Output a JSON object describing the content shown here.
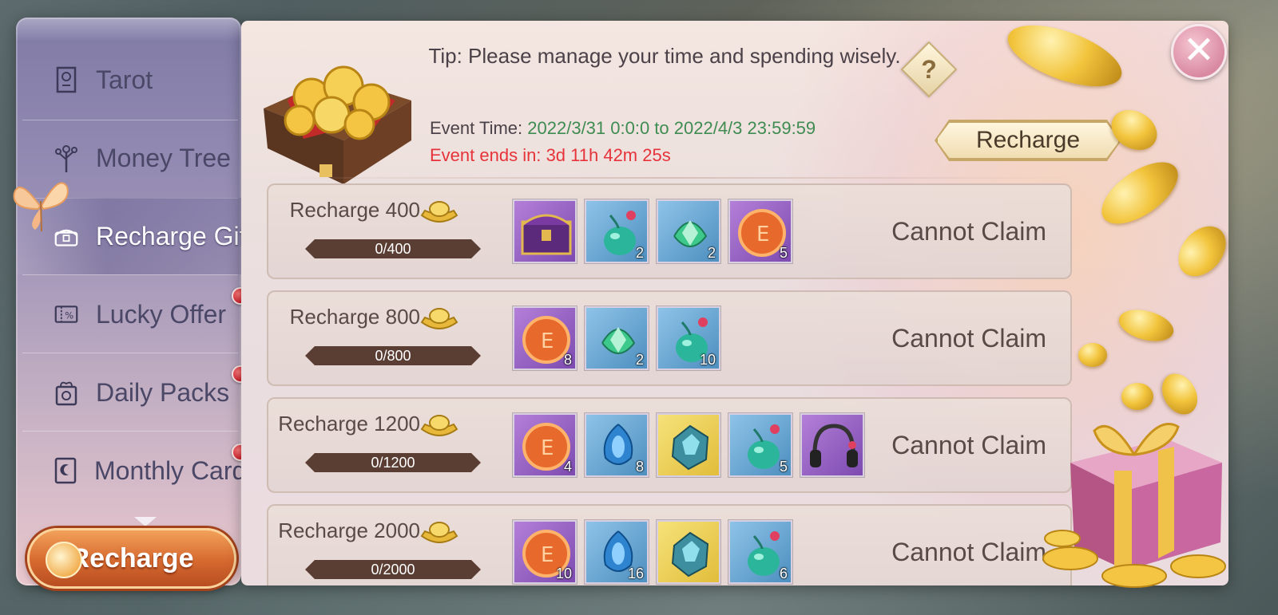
{
  "sidebar": {
    "items": [
      {
        "label": "Tarot",
        "icon": "tarot-card-icon"
      },
      {
        "label": "Money Tree",
        "icon": "money-tree-icon"
      },
      {
        "label": "Recharge Gift",
        "icon": "gift-chest-icon",
        "active": true
      },
      {
        "label": "Lucky Offer",
        "icon": "discount-ticket-icon",
        "badge": true
      },
      {
        "label": "Daily Packs",
        "icon": "daily-pack-icon",
        "badge": true
      },
      {
        "label": "Monthly Card",
        "icon": "monthly-card-icon",
        "badge": true
      }
    ],
    "recharge_label": "Recharge"
  },
  "header": {
    "tip": "Tip: Please manage your time and spending wisely.",
    "help_label": "?",
    "event_time_label": "Event Time:",
    "event_time_value": "2022/3/31 0:0:0 to 2022/4/3 23:59:59",
    "event_ends_label": "Event ends in:",
    "event_ends_value": "3d 11h 42m 25s",
    "recharge_button": "Recharge"
  },
  "tiers": [
    {
      "label": "Recharge 400",
      "progress": "0/400",
      "progress_fraction": 0,
      "status": "Cannot Claim",
      "items": [
        {
          "name": "purple-chest",
          "rarity": "purple",
          "qty": ""
        },
        {
          "name": "teal-potion",
          "rarity": "blue",
          "qty": "2"
        },
        {
          "name": "green-crystal-bag",
          "rarity": "blue",
          "qty": "2"
        },
        {
          "name": "exp-orb",
          "rarity": "purple",
          "qty": "5"
        }
      ]
    },
    {
      "label": "Recharge 800",
      "progress": "0/800",
      "progress_fraction": 0,
      "status": "Cannot Claim",
      "items": [
        {
          "name": "exp-orb",
          "rarity": "purple",
          "qty": "8"
        },
        {
          "name": "green-crystal-bag",
          "rarity": "blue",
          "qty": "2"
        },
        {
          "name": "teal-potion",
          "rarity": "blue",
          "qty": "10"
        }
      ]
    },
    {
      "label": "Recharge 1200",
      "progress": "0/1200",
      "progress_fraction": 0,
      "status": "Cannot Claim",
      "items": [
        {
          "name": "exp-orb",
          "rarity": "purple",
          "qty": "4"
        },
        {
          "name": "blue-gem",
          "rarity": "blue",
          "qty": "8"
        },
        {
          "name": "crystal-ore",
          "rarity": "gold",
          "qty": ""
        },
        {
          "name": "teal-potion",
          "rarity": "blue",
          "qty": "5"
        },
        {
          "name": "headphones",
          "rarity": "purple",
          "qty": ""
        }
      ]
    },
    {
      "label": "Recharge 2000",
      "progress": "0/2000",
      "progress_fraction": 0,
      "status": "Cannot Claim",
      "items": [
        {
          "name": "exp-orb",
          "rarity": "purple",
          "qty": "10"
        },
        {
          "name": "blue-gem",
          "rarity": "blue",
          "qty": "16"
        },
        {
          "name": "crystal-ore",
          "rarity": "gold",
          "qty": ""
        },
        {
          "name": "teal-potion",
          "rarity": "blue",
          "qty": "6"
        }
      ]
    }
  ],
  "colors": {
    "accent_gold": "#e2a843",
    "event_time_green": "#3f8c52",
    "event_ends_red": "#e6333a",
    "recharge_orange": "#d6692f"
  },
  "close_icon": "close-icon"
}
